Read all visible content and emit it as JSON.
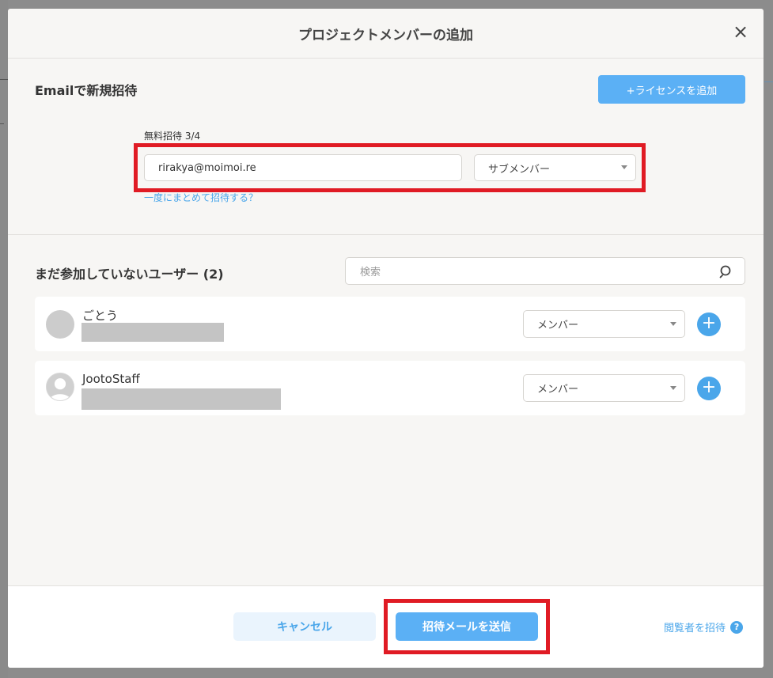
{
  "modal": {
    "title": "プロジェクトメンバーの追加",
    "close_icon": "×"
  },
  "invite": {
    "section_title": "Emailで新規招待",
    "license_button": "+ライセンスを追加",
    "free_label": "無料招待 3/4",
    "email_value": "rirakya@moimoi.re",
    "role_value": "サブメンバー",
    "bulk_link": "一度にまとめて招待する？"
  },
  "pending": {
    "section_title": "まだ参加していないユーザー (2)",
    "search_placeholder": "検索",
    "users": [
      {
        "name": "ごとう",
        "role": "メンバー",
        "add": "+"
      },
      {
        "name": "JootoStaff",
        "role": "メンバー",
        "add": "+"
      }
    ]
  },
  "footer": {
    "cancel_label": "キャンセル",
    "send_label": "招待メールを送信",
    "viewer_link": "閲覧者を招待",
    "help_icon": "?"
  },
  "colors": {
    "accent": "#5bb0f5",
    "highlight": "#e01b24"
  }
}
